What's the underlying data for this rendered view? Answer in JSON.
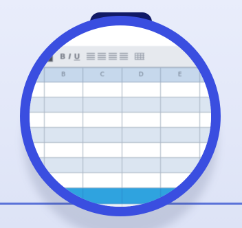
{
  "toolbar": {
    "bold": "B",
    "italic": "I",
    "underline": "U"
  },
  "sheet": {
    "columns": [
      "",
      "B",
      "C",
      "D",
      "E",
      ""
    ],
    "rows": [
      "white",
      "blue",
      "white",
      "blue",
      "white",
      "blue",
      "white",
      "accent",
      "footer"
    ]
  },
  "colors": {
    "lens_ring": "#3a4ee0",
    "lens_tab": "#111a66",
    "header_fill": "#c6d8ec",
    "row_blue": "#dbe5f1",
    "accent_row": "#2fa3df",
    "background": "#e9edfb"
  },
  "icons": {
    "magnifier": "magnifier-lens-icon",
    "align": "align-lines-icon",
    "grid": "table-grid-icon"
  }
}
